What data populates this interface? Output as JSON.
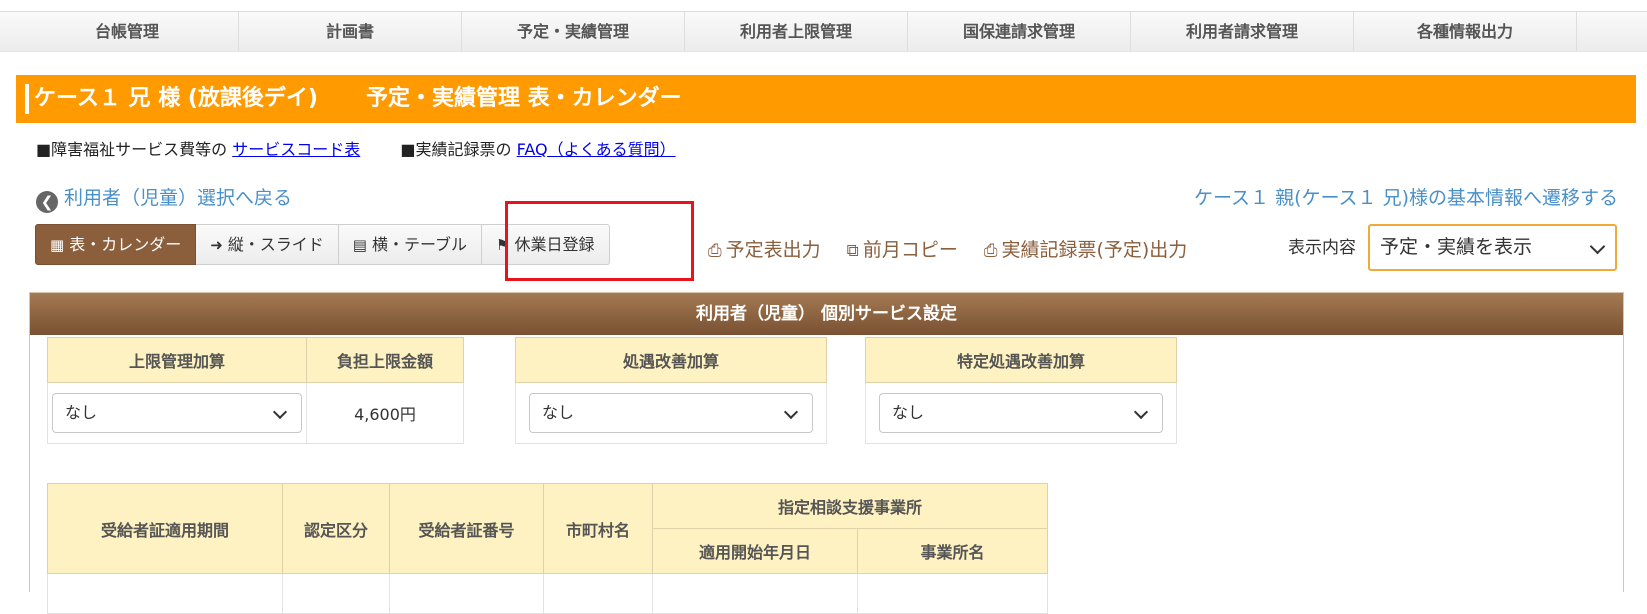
{
  "nav": {
    "tabs": [
      "台帳管理",
      "計画書",
      "予定・実績管理",
      "利用者上限管理",
      "国保連請求管理",
      "利用者請求管理",
      "各種情報出力"
    ]
  },
  "title": {
    "main": "ケース１ 兄 様 (放課後デイ)",
    "sub": "予定・実績管理 表・カレンダー"
  },
  "links": {
    "prefix1": "■障害福祉サービス費等の",
    "link1": "サービスコード表",
    "prefix2": "■実績記録票の",
    "link2": "FAQ（よくある質問）"
  },
  "back_link": "利用者（児童）選択へ戻る",
  "parent_link": "ケース１ 親(ケース１ 兄)様の基本情報へ遷移する",
  "view_buttons": {
    "calendar": "表・カレンダー",
    "slide": "縦・スライド",
    "table": "横・テーブル",
    "holiday": "休業日登録"
  },
  "actions": {
    "schedule_print": "予定表出力",
    "copy_prev": "前月コピー",
    "record_print": "実績記録票(予定)出力"
  },
  "display": {
    "label": "表示内容",
    "value": "予定・実績を表示"
  },
  "panel": {
    "title": "利用者（児童） 個別サービス設定",
    "limit_table": {
      "col1": "上限管理加算",
      "col2": "負担上限金額",
      "select_value": "なし",
      "amount": "4,600円"
    },
    "treat_table": {
      "header": "処遇改善加算",
      "select_value": "なし"
    },
    "special_table": {
      "header": "特定処遇改善加算",
      "select_value": "なし"
    },
    "cert_table": {
      "period": "受給者証適用期間",
      "category": "認定区分",
      "number": "受給者証番号",
      "city": "市町村名",
      "office_group": "指定相談支援事業所",
      "start_date": "適用開始年月日",
      "office_name": "事業所名"
    }
  },
  "colors": {
    "accent_orange": "#ff9a00",
    "brown": "#8b5e3c",
    "highlight_red": "#e8141d",
    "link_blue": "#4a90c8"
  }
}
